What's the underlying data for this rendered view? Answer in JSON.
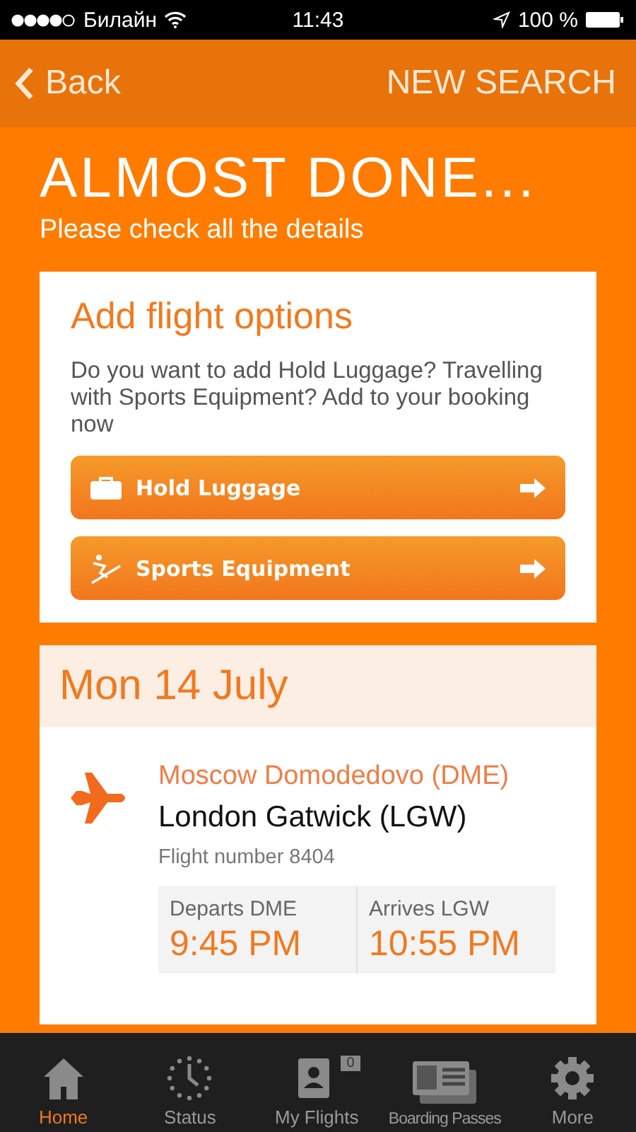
{
  "status_bar": {
    "carrier": "Билайн",
    "time": "11:43",
    "battery": "100 %"
  },
  "nav": {
    "back": "Back",
    "action": "NEW SEARCH"
  },
  "heading": {
    "title": "ALMOST DONE...",
    "subtitle": "Please check all the details"
  },
  "options": {
    "title": "Add flight options",
    "text": "Do you want to add Hold Luggage? Travelling with Sports Equipment? Add to your booking now",
    "buttons": [
      {
        "kind": "luggage",
        "label": "Hold Luggage"
      },
      {
        "kind": "sports",
        "label": "Sports Equipment"
      }
    ]
  },
  "flight": {
    "date": "Mon 14 July",
    "from": "Moscow Domodedovo (DME)",
    "to": "London Gatwick (LGW)",
    "number": "Flight number 8404",
    "times": [
      {
        "label": "Departs DME",
        "time": "9:45 PM"
      },
      {
        "label": "Arrives LGW",
        "time": "10:55 PM"
      }
    ]
  },
  "tabs": [
    {
      "kind": "home",
      "label": "Home",
      "selected": true
    },
    {
      "kind": "status",
      "label": "Status",
      "selected": false
    },
    {
      "kind": "flights",
      "label": "My Flights",
      "badge": "0",
      "selected": false
    },
    {
      "kind": "passes",
      "label": "Boarding Passes",
      "selected": false
    },
    {
      "kind": "more",
      "label": "More",
      "selected": false
    }
  ]
}
